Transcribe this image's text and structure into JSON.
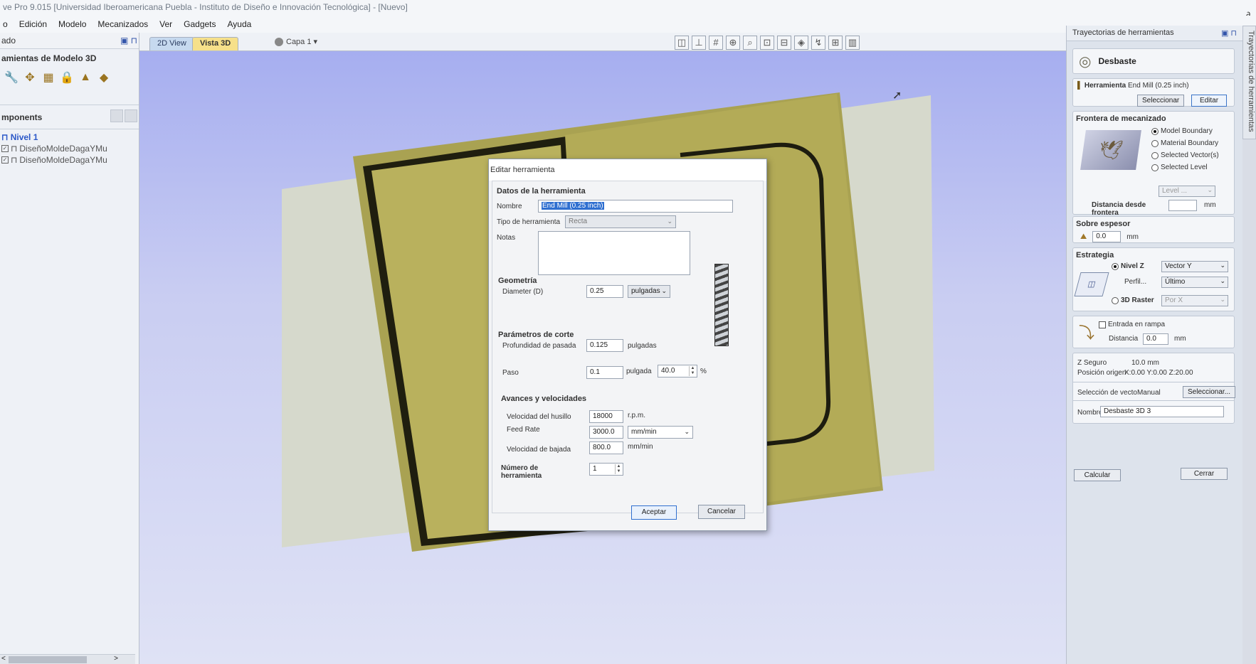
{
  "window": {
    "title": "ve Pro 9.015 [Universidad Iberoamericana Puebla - Instituto de Diseño e Innovación Tecnológica] - [Nuevo]",
    "controls": "_ ∂"
  },
  "menu": [
    "o",
    "Edición",
    "Modelo",
    "Mecanizados",
    "Ver",
    "Gadgets",
    "Ayuda"
  ],
  "left_panel": {
    "header": "ado",
    "section_title": "amientas de Modelo 3D",
    "components_title": "mponents",
    "tree": {
      "level": "Nivel 1",
      "items": [
        "DiseñoMoldeDagaYMu",
        "DiseñoMoldeDagaYMu"
      ]
    }
  },
  "tabs": {
    "tab_2d": "2D View",
    "tab_3d": "Vista 3D",
    "layer": "Capa 1 ▾"
  },
  "right_panel": {
    "title": "Trayectorias de herramientas",
    "vertical_tab": "Trayectorias de herramientas",
    "operation": "Desbaste",
    "tool": {
      "label": "Herramienta",
      "value": "End Mill (0.25 inch)",
      "select_btn": "Seleccionar",
      "edit_btn": "Editar"
    },
    "boundary": {
      "title": "Frontera de mecanizado",
      "options": [
        "Model Boundary",
        "Material Boundary",
        "Selected Vector(s)",
        "Selected Level"
      ],
      "selected": 0,
      "level_select": "Level ...",
      "distance_label": "Distancia desde frontera",
      "distance_unit": "mm"
    },
    "allowance": {
      "title": "Sobre espesor",
      "value": "0.0",
      "unit": "mm"
    },
    "strategy": {
      "title": "Estrategia",
      "z_level": "Nivel Z",
      "z_select": "Vector Y",
      "profile": "Perfil...",
      "profile_select": "Último",
      "raster": "3D Raster",
      "raster_select": "Por X"
    },
    "ramp": {
      "label": "Entrada en rampa",
      "distance_label": "Distancia",
      "distance_value": "0.0",
      "unit": "mm"
    },
    "info": {
      "z_safe_label": "Z Seguro",
      "z_safe_value": "10.0 mm",
      "origin_label": "Posición origen",
      "origin_value": "X:0.00 Y:0.00 Z:20.00"
    },
    "vector_sel": {
      "label": "Selección de vectoManual",
      "button": "Seleccionar..."
    },
    "name": {
      "label": "Nombre",
      "value": "Desbaste 3D 3"
    },
    "buttons": {
      "calc": "Calcular",
      "close": "Cerrar"
    }
  },
  "dialog": {
    "title": "Editar herramienta",
    "tool_data_title": "Datos de la herramienta",
    "name_label": "Nombre",
    "name_value": "End Mill (0.25 inch)",
    "type_label": "Tipo de herramienta",
    "type_value": "Recta",
    "notes_label": "Notas",
    "geometry_title": "Geometría",
    "diameter_label": "Diameter (D)",
    "diameter_value": "0.25",
    "diameter_unit": "pulgadas",
    "cut_params_title": "Parámetros de corte",
    "pass_depth_label": "Profundidad de pasada",
    "pass_depth_value": "0.125",
    "pass_depth_unit": "pulgadas",
    "stepover_label": "Paso",
    "stepover_value": "0.1",
    "stepover_unit": "pulgada",
    "stepover_pct": "40.0",
    "pct_symbol": "%",
    "feeds_title": "Avances y velocidades",
    "spindle_label": "Velocidad del husillo",
    "spindle_value": "18000",
    "spindle_unit": "r.p.m.",
    "feed_label": "Feed Rate",
    "feed_value": "3000.0",
    "feed_unit": "mm/min",
    "plunge_label": "Velocidad de bajada",
    "plunge_value": "800.0",
    "plunge_unit": "mm/min",
    "tool_number_label": "Número de herramienta",
    "tool_number_value": "1",
    "ok": "Aceptar",
    "cancel": "Cancelar"
  }
}
